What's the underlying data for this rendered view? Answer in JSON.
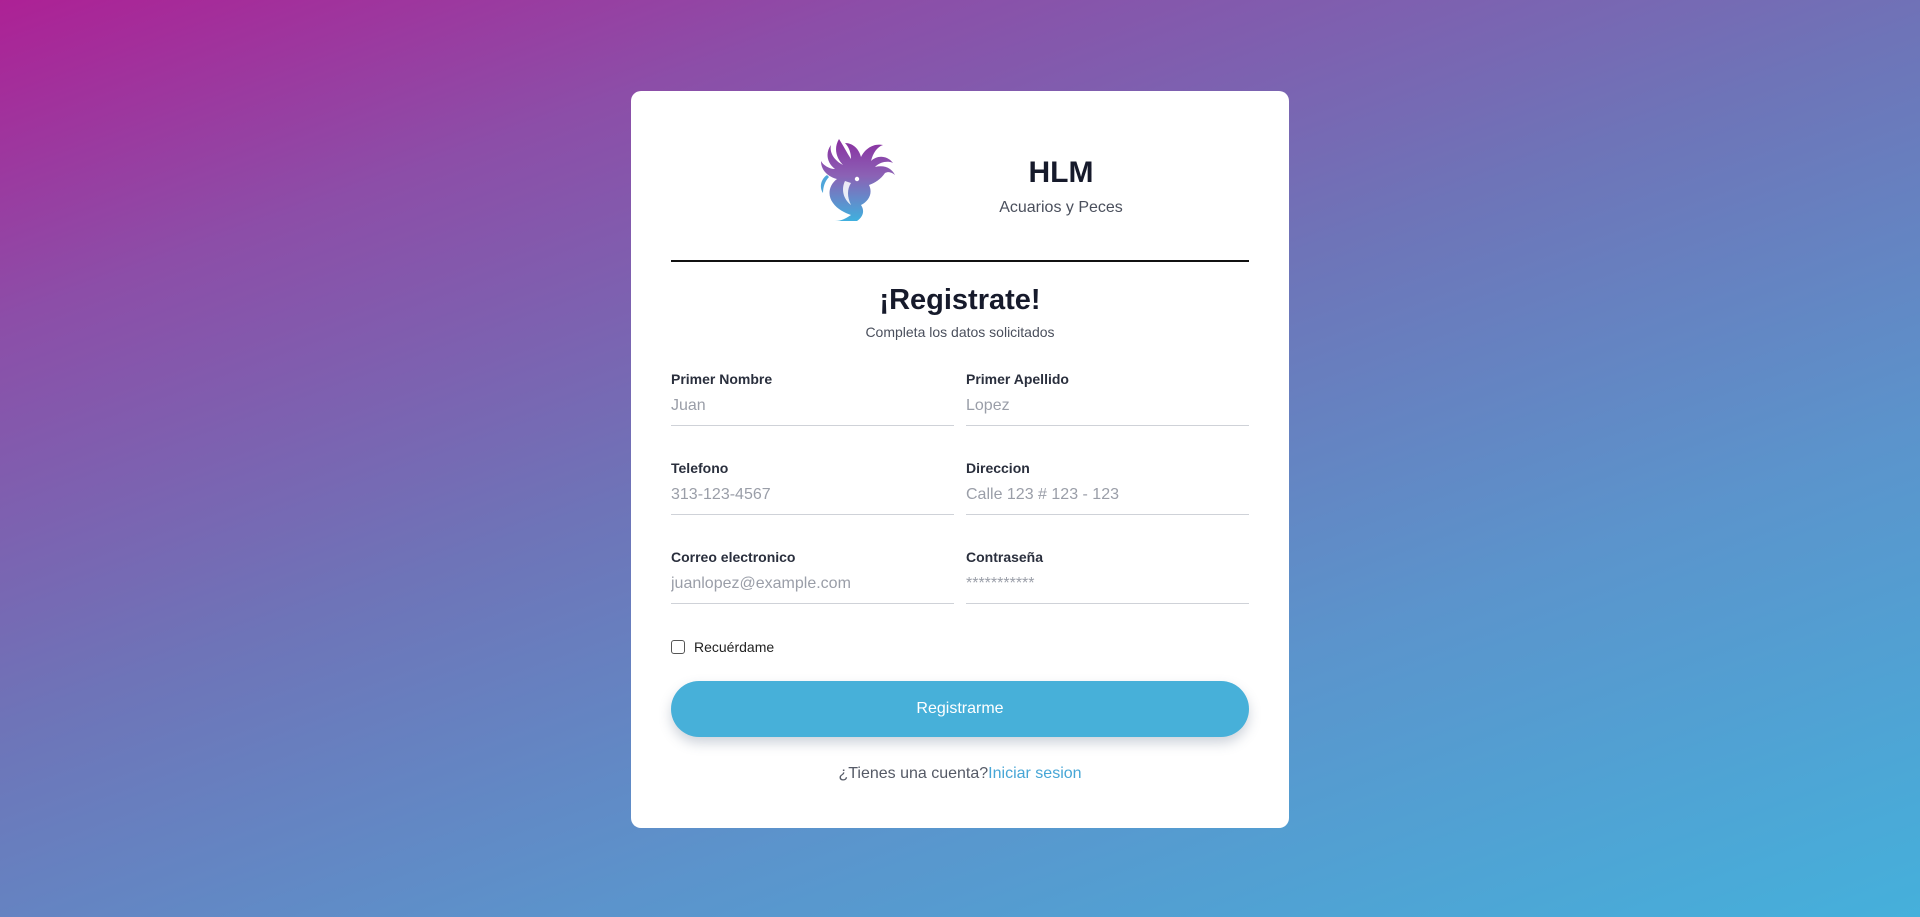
{
  "brand": {
    "name": "HLM",
    "tagline": "Acuarios y Peces"
  },
  "form": {
    "title": "¡Registrate!",
    "subtitle": "Completa los datos solicitados",
    "fields": {
      "first_name": {
        "label": "Primer Nombre",
        "placeholder": "Juan"
      },
      "last_name": {
        "label": "Primer Apellido",
        "placeholder": "Lopez"
      },
      "phone": {
        "label": "Telefono",
        "placeholder": "313-123-4567"
      },
      "address": {
        "label": "Direccion",
        "placeholder": "Calle 123 # 123 - 123"
      },
      "email": {
        "label": "Correo electronico",
        "placeholder": "juanlopez@example.com"
      },
      "password": {
        "label": "Contraseña",
        "placeholder": "***********"
      }
    },
    "remember_label": "Recuérdame",
    "submit_label": "Registrarme",
    "footer_text": "¿Tienes una cuenta?",
    "footer_link": "Iniciar sesion"
  },
  "colors": {
    "accent": "#47b0d9",
    "link": "#47a6d6",
    "gradient_start": "#ad2195",
    "gradient_end": "#45b0db"
  },
  "icons": {
    "logo": "fish-logo-icon",
    "checkbox": "checkbox-unchecked-icon"
  }
}
